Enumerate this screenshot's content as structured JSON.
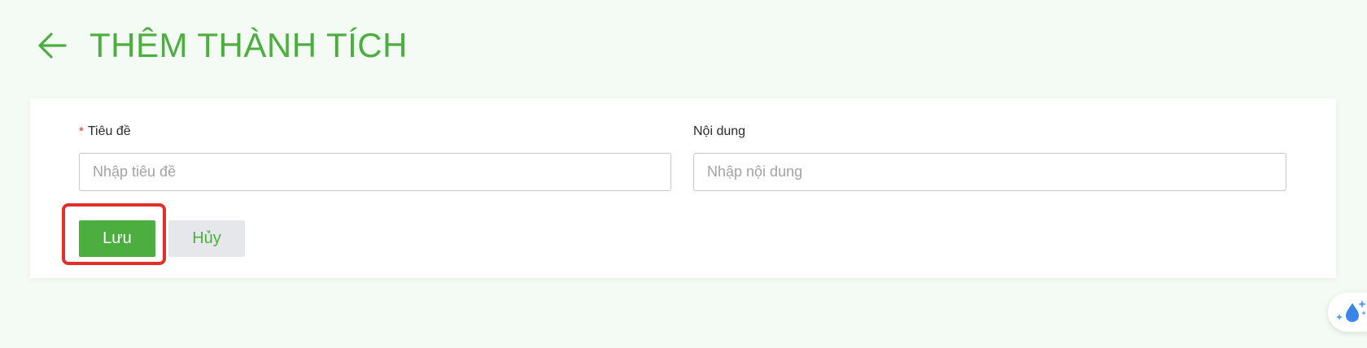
{
  "header": {
    "title": "THÊM THÀNH TÍCH",
    "back_icon": "arrow-left-icon"
  },
  "form": {
    "title_field": {
      "required_mark": "*",
      "label": "Tiêu đề",
      "placeholder": "Nhập tiêu đề",
      "value": ""
    },
    "content_field": {
      "label": "Nội dung",
      "placeholder": "Nhập nội dung",
      "value": ""
    },
    "save_label": "Lưu",
    "cancel_label": "Hủy"
  },
  "floating_widget": {
    "icon": "water-drop-sparkle-icon"
  },
  "colors": {
    "accent": "#4cae3f",
    "required": "#e02f2f",
    "highlight": "#e0302a",
    "background": "#f4fbf4",
    "cancel_bg": "#e6e7ea",
    "widget_icon": "#3a86e8"
  }
}
